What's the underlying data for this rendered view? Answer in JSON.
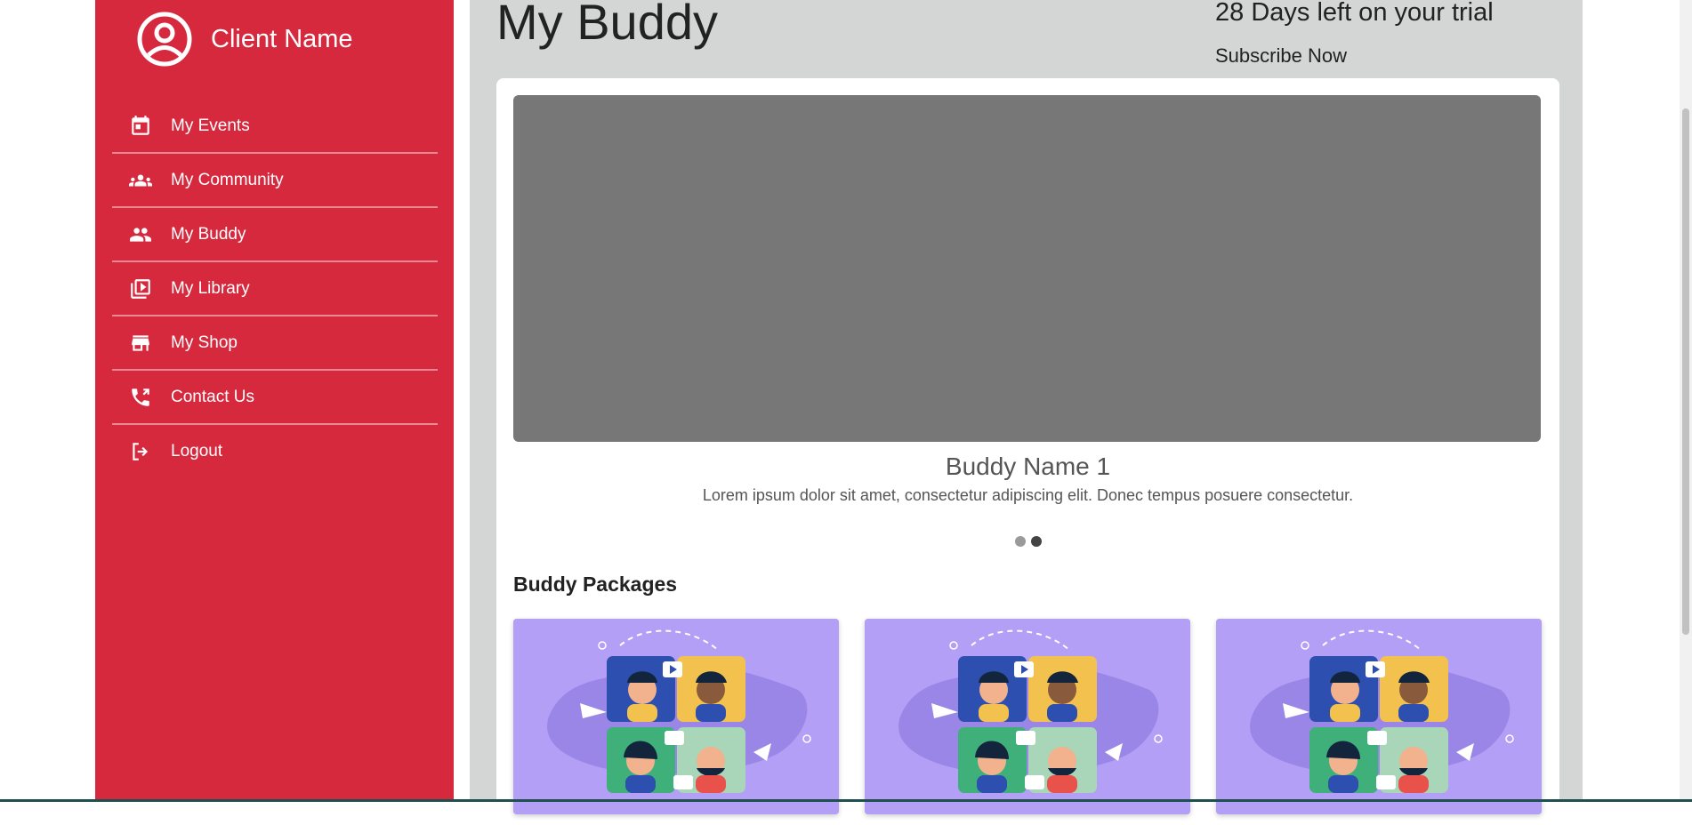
{
  "sidebar": {
    "client_name": "Client Name",
    "avatar_icon": "user-circle-icon",
    "items": [
      {
        "label": "My Events",
        "icon": "calendar-icon"
      },
      {
        "label": "My Community",
        "icon": "community-icon"
      },
      {
        "label": "My Buddy",
        "icon": "people-icon"
      },
      {
        "label": "My Library",
        "icon": "video-library-icon"
      },
      {
        "label": "My Shop",
        "icon": "store-icon"
      },
      {
        "label": "Contact Us",
        "icon": "phone-icon"
      },
      {
        "label": "Logout",
        "icon": "logout-icon"
      }
    ]
  },
  "header": {
    "title": "My Buddy",
    "trial_text": "28 Days left on your trial",
    "subscribe_label": "Subscribe Now"
  },
  "carousel": {
    "title": "Buddy Name 1",
    "description": "Lorem ipsum dolor sit amet, consectetur adipiscing elit. Donec tempus posuere consectetur.",
    "dot_count": 2,
    "active_index": 1
  },
  "packages": {
    "title": "Buddy Packages",
    "count": 3
  },
  "colors": {
    "sidebar_bg": "#d7293e",
    "main_bg": "#d4d5d5",
    "slide_bg": "#777777",
    "package_bg": "#b39ff5"
  }
}
